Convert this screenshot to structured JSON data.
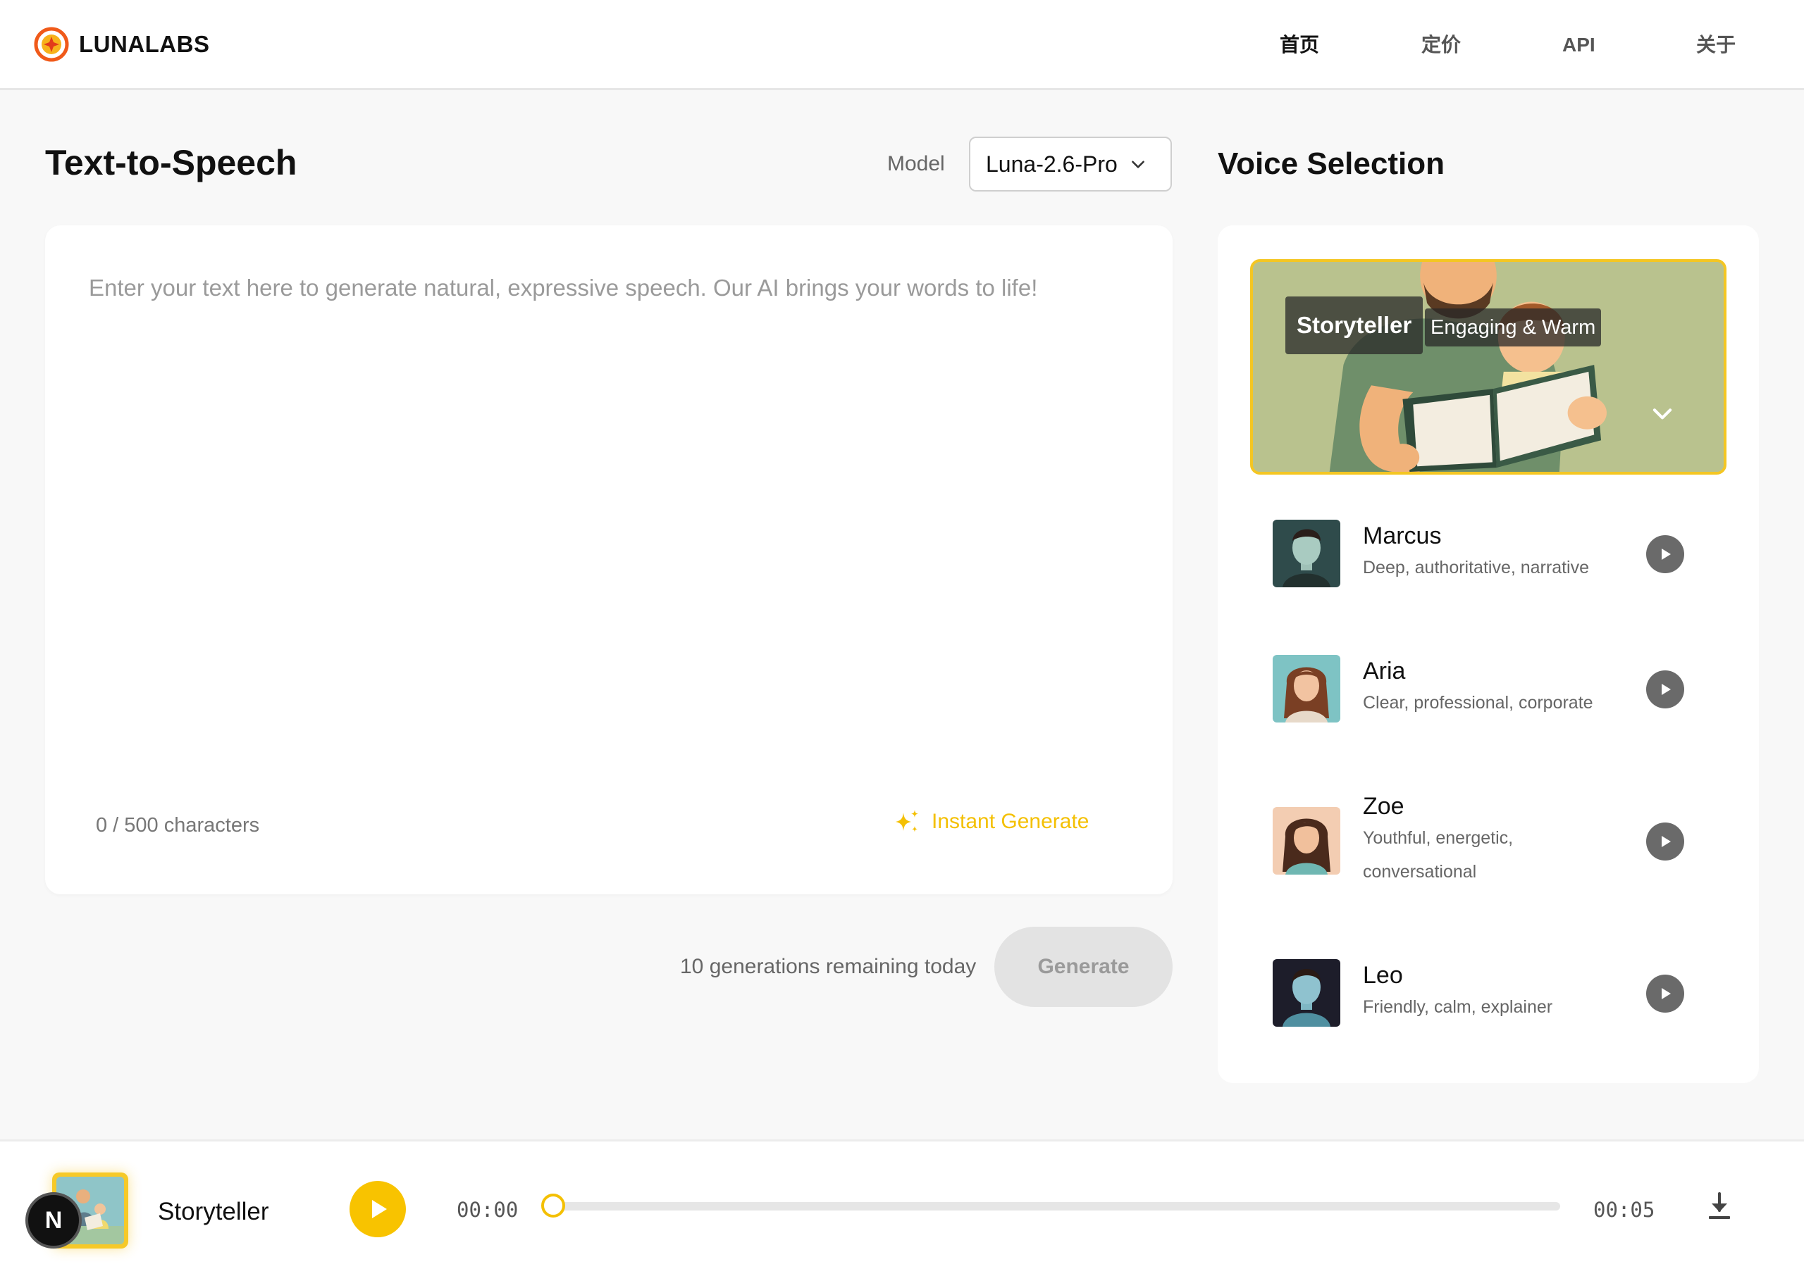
{
  "app": {
    "brand": "LUNALABS"
  },
  "nav": {
    "items": [
      {
        "label": "首页",
        "active": true
      },
      {
        "label": "定价",
        "active": false
      },
      {
        "label": "API",
        "active": false
      },
      {
        "label": "关于",
        "active": false
      }
    ]
  },
  "tts": {
    "title": "Text-to-Speech",
    "model_label": "Model",
    "model_value": "Luna-2.6-Pro",
    "placeholder": "Enter your text here to generate natural, expressive speech. Our AI brings your words to life!",
    "text_value": "",
    "char_count": "0 / 500 characters",
    "instant_generate": "Instant Generate",
    "remaining": "10 generations remaining today",
    "generate_label": "Generate"
  },
  "voices": {
    "title": "Voice Selection",
    "featured": {
      "name": "Storyteller",
      "tag": "Engaging & Warm",
      "icon": "chevron-down-icon"
    },
    "items": [
      {
        "name": "Marcus",
        "desc": "Deep, authoritative, narrative",
        "avatar_bg": "#2f4b4b"
      },
      {
        "name": "Aria",
        "desc": "Clear, professional, corporate",
        "avatar_bg": "#7ec3c4"
      },
      {
        "name": "Zoe",
        "desc": "Youthful, energetic, conversational",
        "avatar_bg": "#f3cdb2"
      },
      {
        "name": "Leo",
        "desc": "Friendly, calm, explainer",
        "avatar_bg": "#1d1d2a"
      }
    ]
  },
  "player": {
    "voice_name": "Storyteller",
    "current_time": "00:00",
    "total_time": "00:05",
    "progress": 0,
    "badge": "N"
  },
  "colors": {
    "accent": "#f8c300",
    "background": "#f8f8f8",
    "play_button": "#6a6a6a"
  }
}
